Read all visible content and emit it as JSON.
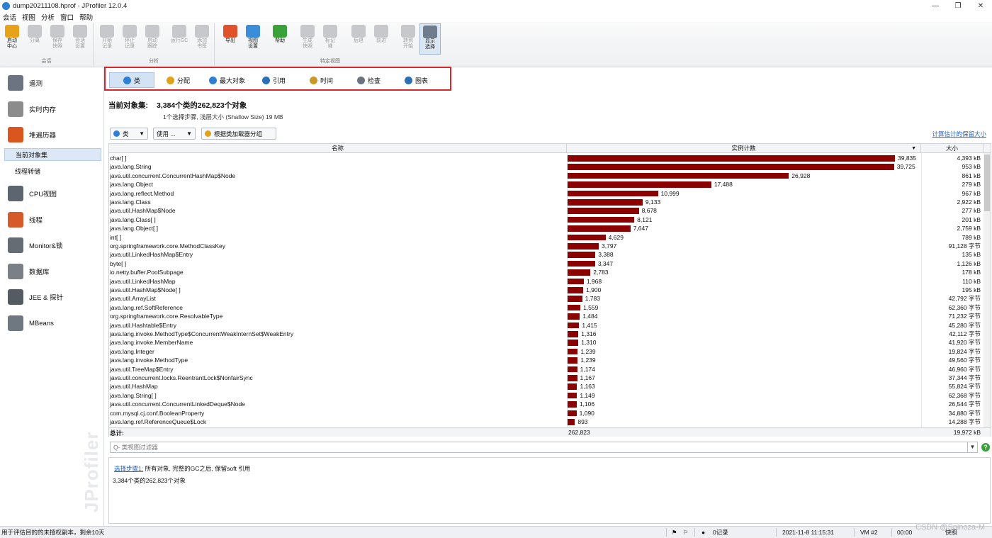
{
  "window": {
    "title": "dump20211108.hprof - JProfiler 12.0.4",
    "minimize": "—",
    "maximize": "❐",
    "close": "✕"
  },
  "menu": [
    "会话",
    "视图",
    "分析",
    "窗口",
    "帮助"
  ],
  "toolbar": {
    "buttons": [
      {
        "label": "启动\n中心",
        "name": "start-center-button",
        "enabled": true,
        "color": "#e8a21a"
      },
      {
        "label": "分离",
        "name": "detach-button",
        "enabled": false
      },
      {
        "label": "保存\n快照",
        "name": "save-snapshot-button",
        "enabled": false
      },
      {
        "label": "会话\n设置",
        "name": "session-settings-button",
        "enabled": false
      },
      {
        "label": "开始\n记录",
        "name": "start-recording-button",
        "enabled": false
      },
      {
        "label": "停止\n记录",
        "name": "stop-recording-button",
        "enabled": false
      },
      {
        "label": "启动\n跟踪",
        "name": "start-tracking-button",
        "enabled": false
      },
      {
        "label": "运行GC",
        "name": "run-gc-button",
        "enabled": false
      },
      {
        "label": "添加\n书签",
        "name": "add-bookmark-button",
        "enabled": false
      },
      {
        "label": "导出",
        "name": "export-button",
        "enabled": true,
        "color": "#e0522a"
      },
      {
        "label": "视图\n设置",
        "name": "view-settings-button",
        "enabled": true,
        "color": "#3a8dd8"
      },
      {
        "label": "帮助",
        "name": "help-button",
        "enabled": true,
        "color": "#39a339"
      },
      {
        "label": "生成\n快照",
        "name": "take-snapshot-button",
        "enabled": false
      },
      {
        "label": "标记\n堆",
        "name": "mark-heap-button",
        "enabled": false
      },
      {
        "label": "后退",
        "name": "back-button",
        "enabled": false
      },
      {
        "label": "前进",
        "name": "forward-button",
        "enabled": false
      },
      {
        "label": "转到\n开始",
        "name": "go-to-start-button",
        "enabled": false
      },
      {
        "label": "显示\n选择",
        "name": "show-selection-button",
        "enabled": true,
        "color": "#6f7d8c",
        "active": true
      }
    ],
    "groups": [
      "会话",
      "分析",
      "特定视图"
    ]
  },
  "sidebar": {
    "items": [
      {
        "label": "遥测",
        "name": "sidebar-item-telemetry",
        "color": "#6b7480"
      },
      {
        "label": "实时内存",
        "name": "sidebar-item-live-memory",
        "color": "#8c8c8c"
      },
      {
        "label": "堆遍历器",
        "name": "sidebar-item-heap-walker",
        "color": "#d9571f"
      },
      {
        "label": "CPU视图",
        "name": "sidebar-item-cpu-views",
        "color": "#5d6670"
      },
      {
        "label": "线程",
        "name": "sidebar-item-threads",
        "color": "#d65a2a"
      },
      {
        "label": "Monitor&锁",
        "name": "sidebar-item-monitors-locks",
        "color": "#666c73"
      },
      {
        "label": "数据库",
        "name": "sidebar-item-databases",
        "color": "#7b8087"
      },
      {
        "label": "JEE & 探针",
        "name": "sidebar-item-jee-probes",
        "color": "#555b62"
      },
      {
        "label": "MBeans",
        "name": "sidebar-item-mbeans",
        "color": "#6f7780"
      }
    ],
    "subitems": [
      "当前对象集",
      "线程转储"
    ],
    "brand": "JProfiler"
  },
  "tabs": [
    {
      "label": "类",
      "name": "tab-classes",
      "color": "#2f7fd4"
    },
    {
      "label": "分配",
      "name": "tab-allocations",
      "color": "#e1a21b"
    },
    {
      "label": "最大对象",
      "name": "tab-biggest-objects",
      "color": "#2f7fd4"
    },
    {
      "label": "引用",
      "name": "tab-references",
      "color": "#2a6fb8"
    },
    {
      "label": "时间",
      "name": "tab-time",
      "color": "#c99a2a"
    },
    {
      "label": "检查",
      "name": "tab-inspections",
      "color": "#6b7480"
    },
    {
      "label": "图表",
      "name": "tab-graph",
      "color": "#2a6fb8"
    }
  ],
  "header": {
    "title": "当前对象集:",
    "count": "3,384个类的262,823个对象",
    "subtitle": "1个选择步骤, 浅层大小 (Shallow Size) 19 MB"
  },
  "controls": {
    "aggregation": "类",
    "usage": "使用 ...",
    "group_by_loader": "根据类加载器分组",
    "retained_link": "计算估计的保留大小"
  },
  "table": {
    "columns": [
      "名称",
      "实例计数",
      "大小"
    ],
    "max_count": 39835,
    "rows": [
      {
        "name": "char[ ]",
        "count": 39835,
        "count_label": "39,835",
        "size": "4,393 kB"
      },
      {
        "name": "java.lang.String",
        "count": 39725,
        "count_label": "39,725",
        "size": "953 kB"
      },
      {
        "name": "java.util.concurrent.ConcurrentHashMap$Node",
        "count": 26928,
        "count_label": "26,928",
        "size": "861 kB"
      },
      {
        "name": "java.lang.Object",
        "count": 17488,
        "count_label": "17,488",
        "size": "279 kB"
      },
      {
        "name": "java.lang.reflect.Method",
        "count": 10999,
        "count_label": "10,999",
        "size": "967 kB"
      },
      {
        "name": "java.lang.Class",
        "count": 9133,
        "count_label": "9,133",
        "size": "2,922 kB"
      },
      {
        "name": "java.util.HashMap$Node",
        "count": 8678,
        "count_label": "8,678",
        "size": "277 kB"
      },
      {
        "name": "java.lang.Class[ ]",
        "count": 8121,
        "count_label": "8,121",
        "size": "201 kB"
      },
      {
        "name": "java.lang.Object[ ]",
        "count": 7647,
        "count_label": "7,647",
        "size": "2,759 kB"
      },
      {
        "name": "int[ ]",
        "count": 4629,
        "count_label": "4,629",
        "size": "789 kB"
      },
      {
        "name": "org.springframework.core.MethodClassKey",
        "count": 3797,
        "count_label": "3,797",
        "size": "91,128 字节"
      },
      {
        "name": "java.util.LinkedHashMap$Entry",
        "count": 3388,
        "count_label": "3,388",
        "size": "135 kB"
      },
      {
        "name": "byte[ ]",
        "count": 3347,
        "count_label": "3,347",
        "size": "1,126 kB"
      },
      {
        "name": "io.netty.buffer.PoolSubpage",
        "count": 2783,
        "count_label": "2,783",
        "size": "178 kB"
      },
      {
        "name": "java.util.LinkedHashMap",
        "count": 1968,
        "count_label": "1,968",
        "size": "110 kB"
      },
      {
        "name": "java.util.HashMap$Node[ ]",
        "count": 1900,
        "count_label": "1,900",
        "size": "195 kB"
      },
      {
        "name": "java.util.ArrayList",
        "count": 1783,
        "count_label": "1,783",
        "size": "42,792 字节"
      },
      {
        "name": "java.lang.ref.SoftReference",
        "count": 1559,
        "count_label": "1,559",
        "size": "62,360 字节"
      },
      {
        "name": "org.springframework.core.ResolvableType",
        "count": 1484,
        "count_label": "1,484",
        "size": "71,232 字节"
      },
      {
        "name": "java.util.Hashtable$Entry",
        "count": 1415,
        "count_label": "1,415",
        "size": "45,280 字节"
      },
      {
        "name": "java.lang.invoke.MethodType$ConcurrentWeakInternSet$WeakEntry",
        "count": 1316,
        "count_label": "1,316",
        "size": "42,112 字节"
      },
      {
        "name": "java.lang.invoke.MemberName",
        "count": 1310,
        "count_label": "1,310",
        "size": "41,920 字节"
      },
      {
        "name": "java.lang.Integer",
        "count": 1239,
        "count_label": "1,239",
        "size": "19,824 字节"
      },
      {
        "name": "java.lang.invoke.MethodType",
        "count": 1239,
        "count_label": "1,239",
        "size": "49,560 字节"
      },
      {
        "name": "java.util.TreeMap$Entry",
        "count": 1174,
        "count_label": "1,174",
        "size": "46,960 字节"
      },
      {
        "name": "java.util.concurrent.locks.ReentrantLock$NonfairSync",
        "count": 1167,
        "count_label": "1,167",
        "size": "37,344 字节"
      },
      {
        "name": "java.util.HashMap",
        "count": 1163,
        "count_label": "1,163",
        "size": "55,824 字节"
      },
      {
        "name": "java.lang.String[ ]",
        "count": 1149,
        "count_label": "1,149",
        "size": "62,368 字节"
      },
      {
        "name": "java.util.concurrent.ConcurrentLinkedDeque$Node",
        "count": 1106,
        "count_label": "1,106",
        "size": "26,544 字节"
      },
      {
        "name": "com.mysql.cj.conf.BooleanProperty",
        "count": 1090,
        "count_label": "1,090",
        "size": "34,880 字节"
      },
      {
        "name": "java.lang.ref.ReferenceQueue$Lock",
        "count": 893,
        "count_label": "893",
        "size": "14,288 字节"
      }
    ],
    "total": {
      "label": "总计:",
      "count": "262,823",
      "size": "19,972 kB"
    }
  },
  "filter": {
    "placeholder": "Q- 类视图过滤器",
    "help": "?"
  },
  "info": {
    "step_link": "选择步骤1:",
    "step_text": " 所有对象, 完整的GC之后, 保留soft 引用",
    "summary": "3,384个类的262,823个对象"
  },
  "status": {
    "license": "用于评估目的的未授权副本，剩余10天",
    "records": "0记录",
    "datetime": "2021-11-8 11:15:31",
    "vm": "VM #2",
    "time": "00:00",
    "snapshot": "快照"
  },
  "watermark": "CSDN @Spinoza-M"
}
